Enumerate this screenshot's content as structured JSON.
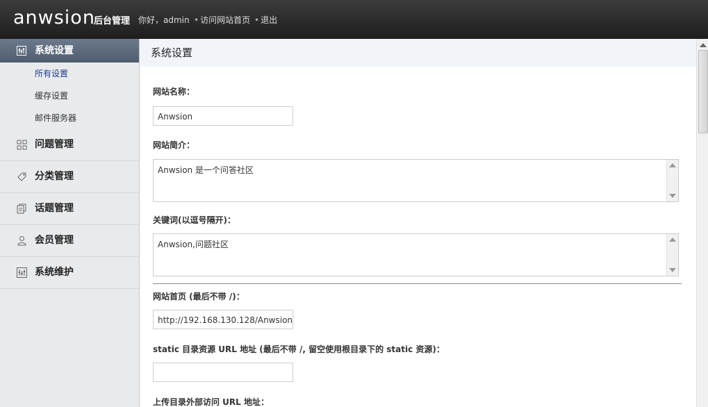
{
  "header": {
    "logo": "anwsion",
    "title": "后台管理",
    "greeting": "你好，admin",
    "visit_site": "访问网站首页",
    "logout": "退出"
  },
  "sidebar": {
    "active_group": {
      "label": "系统设置",
      "subitems": [
        "所有设置",
        "缓存设置",
        "邮件服务器"
      ]
    },
    "items": [
      {
        "label": "问题管理",
        "icon": "question-manage-icon"
      },
      {
        "label": "分类管理",
        "icon": "category-icon"
      },
      {
        "label": "话题管理",
        "icon": "topic-icon"
      },
      {
        "label": "会员管理",
        "icon": "member-icon"
      },
      {
        "label": "系统维护",
        "icon": "maintenance-icon"
      }
    ]
  },
  "main": {
    "title": "系统设置",
    "fields": {
      "site_name_label": "网站名称：",
      "site_name_value": "Anwsion",
      "site_desc_label": "网站简介：",
      "site_desc_value": "Anwsion 是一个问答社区",
      "keywords_label": "关键词(以逗号隔开)：",
      "keywords_value": "Anwsion,问题社区",
      "homepage_label": "网站首页 (最后不带 /)：",
      "homepage_value": "http://192.168.130.128/Anwsion",
      "static_label": "static 目录资源 URL 地址 (最后不带 /, 留空使用根目录下的 static 资源)：",
      "static_value": "",
      "upload_label": "上传目录外部访问 URL 地址："
    }
  }
}
